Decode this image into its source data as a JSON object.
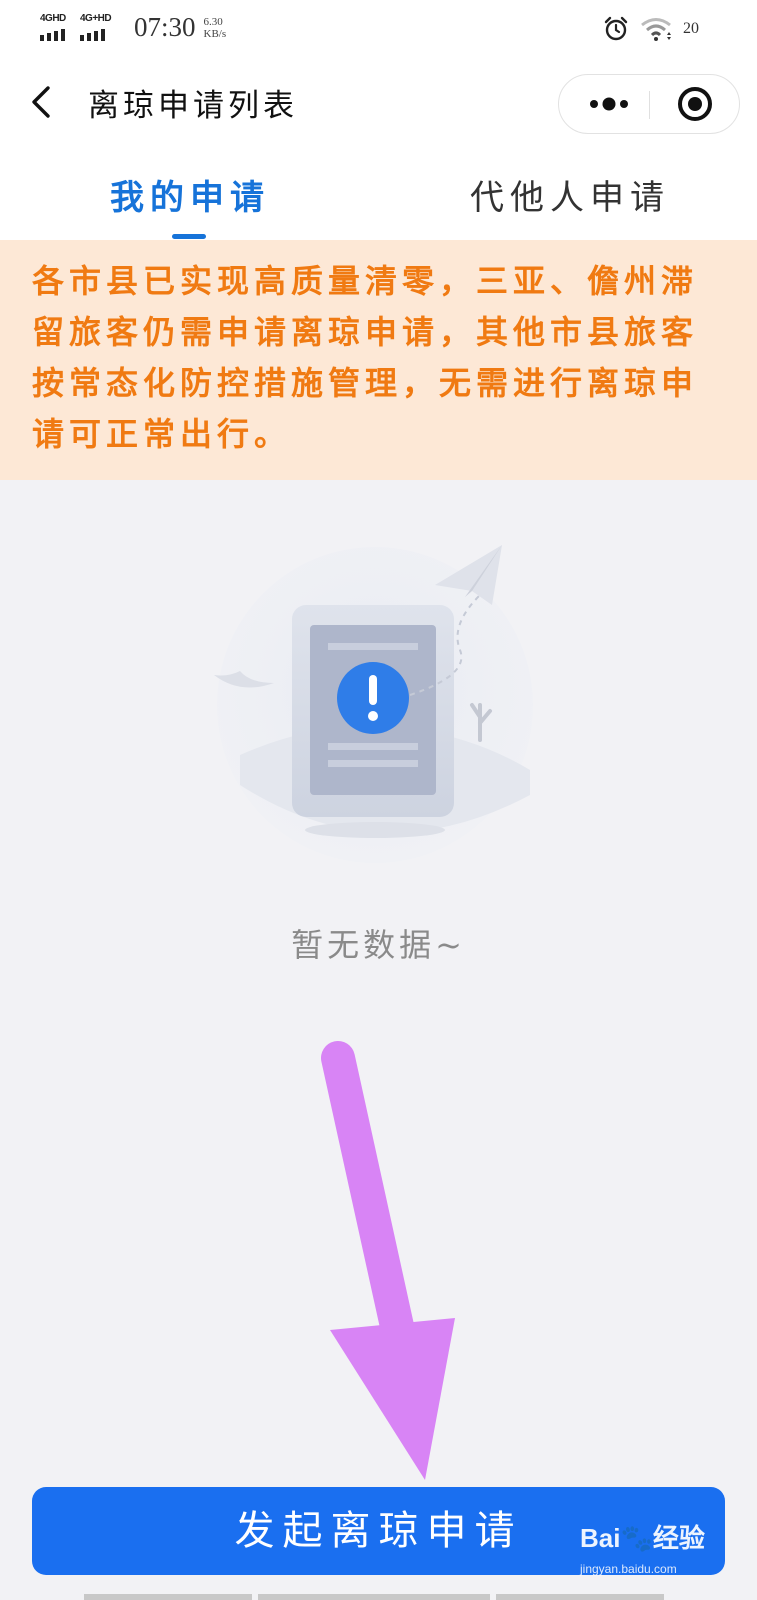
{
  "status_bar": {
    "network1": "4GHD",
    "network2": "4G+HD",
    "time": "07:30",
    "speed_value": "6.30",
    "speed_unit": "KB/s",
    "battery": "20",
    "icons": [
      "signal-icon",
      "alarm-icon",
      "wifi-icon"
    ]
  },
  "nav": {
    "title": "离琼申请列表",
    "icons": [
      "back-icon",
      "more-icon",
      "close-icon"
    ]
  },
  "tabs": [
    {
      "label": "我的申请",
      "active": true
    },
    {
      "label": "代他人申请",
      "active": false
    }
  ],
  "notice": {
    "text": "各市县已实现高质量清零，三亚、儋州滞留旅客仍需申请离琼申请，其他市县旅客按常态化防控措施管理，无需进行离琼申请可正常出行。"
  },
  "empty_state": {
    "text": "暂无数据~",
    "icon": "empty-document-icon"
  },
  "primary_button": {
    "label": "发起离琼申请"
  },
  "watermark": {
    "text": "Bai🐾经验",
    "sub": "jingyan.baidu.com"
  },
  "colors": {
    "accent": "#1a6ff0",
    "tab_active": "#1673d9",
    "notice_bg": "#fde8d6",
    "notice_text": "#f07a12",
    "arrow": "#d884f5"
  }
}
